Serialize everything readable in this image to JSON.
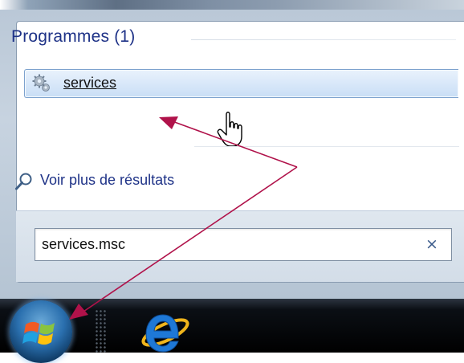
{
  "start_menu": {
    "section_header": "Programmes (1)",
    "result_item": {
      "label": "services",
      "icon": "gear-icon"
    },
    "more_results": {
      "label": "Voir plus de résultats",
      "icon": "magnifier-icon"
    },
    "search": {
      "value": "services.msc",
      "clear_symbol": "×"
    }
  },
  "taskbar": {
    "start_button": {
      "icon": "windows-logo-icon"
    },
    "pinned": [
      {
        "icon": "internet-explorer-icon"
      }
    ]
  },
  "annotation": {
    "arrow_color": "#b0124a"
  }
}
